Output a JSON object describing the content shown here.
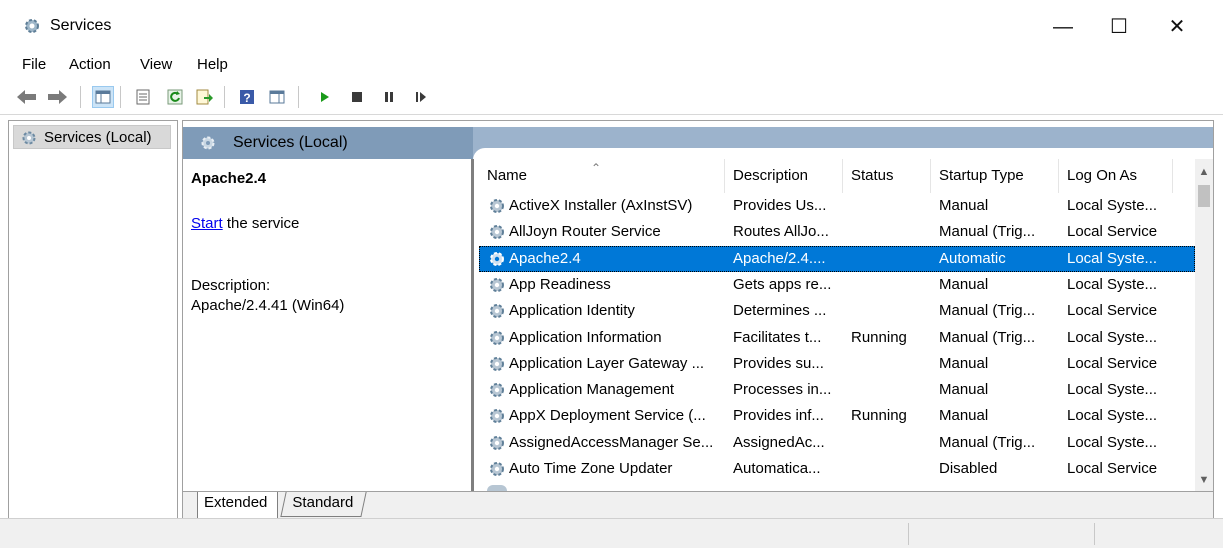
{
  "window": {
    "title": "Services",
    "icon": "gear-icon"
  },
  "menu": [
    "File",
    "Action",
    "View",
    "Help"
  ],
  "tree": {
    "item_label": "Services (Local)"
  },
  "pane": {
    "header_title": "Services (Local)",
    "detail": {
      "service_name": "Apache2.4",
      "start_link": "Start",
      "start_suffix": " the service",
      "description_label": "Description:",
      "description_value": "Apache/2.4.41 (Win64)"
    },
    "columns": [
      "Name",
      "Description",
      "Status",
      "Startup Type",
      "Log On As"
    ],
    "rows": [
      {
        "name": "ActiveX Installer (AxInstSV)",
        "description": "Provides Us...",
        "status": "",
        "startup": "Manual",
        "logon": "Local Syste..."
      },
      {
        "name": "AllJoyn Router Service",
        "description": "Routes AllJo...",
        "status": "",
        "startup": "Manual (Trig...",
        "logon": "Local Service"
      },
      {
        "name": "Apache2.4",
        "description": "Apache/2.4....",
        "status": "",
        "startup": "Automatic",
        "logon": "Local Syste..."
      },
      {
        "name": "App Readiness",
        "description": "Gets apps re...",
        "status": "",
        "startup": "Manual",
        "logon": "Local Syste..."
      },
      {
        "name": "Application Identity",
        "description": "Determines ...",
        "status": "",
        "startup": "Manual (Trig...",
        "logon": "Local Service"
      },
      {
        "name": "Application Information",
        "description": "Facilitates t...",
        "status": "Running",
        "startup": "Manual (Trig...",
        "logon": "Local Syste..."
      },
      {
        "name": "Application Layer Gateway ...",
        "description": "Provides su...",
        "status": "",
        "startup": "Manual",
        "logon": "Local Service"
      },
      {
        "name": "Application Management",
        "description": "Processes in...",
        "status": "",
        "startup": "Manual",
        "logon": "Local Syste..."
      },
      {
        "name": "AppX Deployment Service (...",
        "description": "Provides inf...",
        "status": "Running",
        "startup": "Manual",
        "logon": "Local Syste..."
      },
      {
        "name": "AssignedAccessManager Se...",
        "description": "AssignedAc...",
        "status": "",
        "startup": "Manual (Trig...",
        "logon": "Local Syste..."
      },
      {
        "name": "Auto Time Zone Updater",
        "description": "Automatica...",
        "status": "",
        "startup": "Disabled",
        "logon": "Local Service"
      }
    ],
    "selected_row": 2,
    "tabs": [
      "Extended",
      "Standard"
    ],
    "active_tab": "Extended"
  },
  "colors": {
    "selection": "#0078d7",
    "header_band": "#9cb3cc",
    "link": "#0000ee"
  }
}
